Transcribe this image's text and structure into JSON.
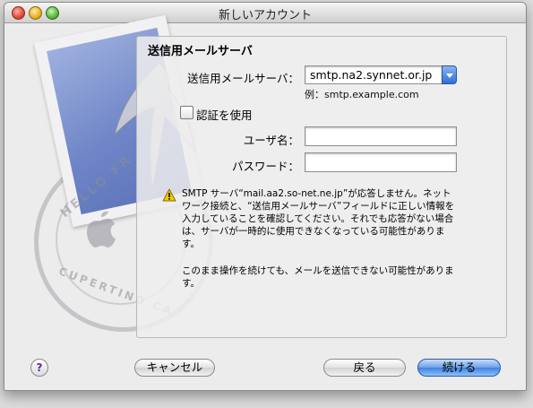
{
  "window": {
    "title": "新しいアカウント"
  },
  "section": {
    "title": "送信用メールサーバ"
  },
  "smtp": {
    "label": "送信用メールサーバ：",
    "value": "smtp.na2.synnet.or.jp",
    "example": "例：smtp.example.com"
  },
  "auth": {
    "label": "認証を使用",
    "checked": false
  },
  "username": {
    "label": "ユーザ名：",
    "value": ""
  },
  "password": {
    "label": "パスワード：",
    "value": ""
  },
  "warning": {
    "icon": "warning-icon",
    "message": "SMTP サーバ“mail.aa2.so-net.ne.jp”が応答しません。ネットワーク接続と、“送信用メールサーバ”フィールドに正しい情報を入力していることを確認してください。それでも応答がない場合は、サーバが一時的に使用できなくなっている可能性があります。",
    "note": "このまま操作を続けても、メールを送信できない可能性があります。"
  },
  "stamp": {
    "top_text": "HELLO FR",
    "bottom_text": "CUPERTINO CA"
  },
  "buttons": {
    "help": "?",
    "cancel": "キャンセル",
    "back": "戻る",
    "continue": "続ける"
  },
  "colors": {
    "accent": "#3f82e0",
    "warning": "#f5c800"
  }
}
